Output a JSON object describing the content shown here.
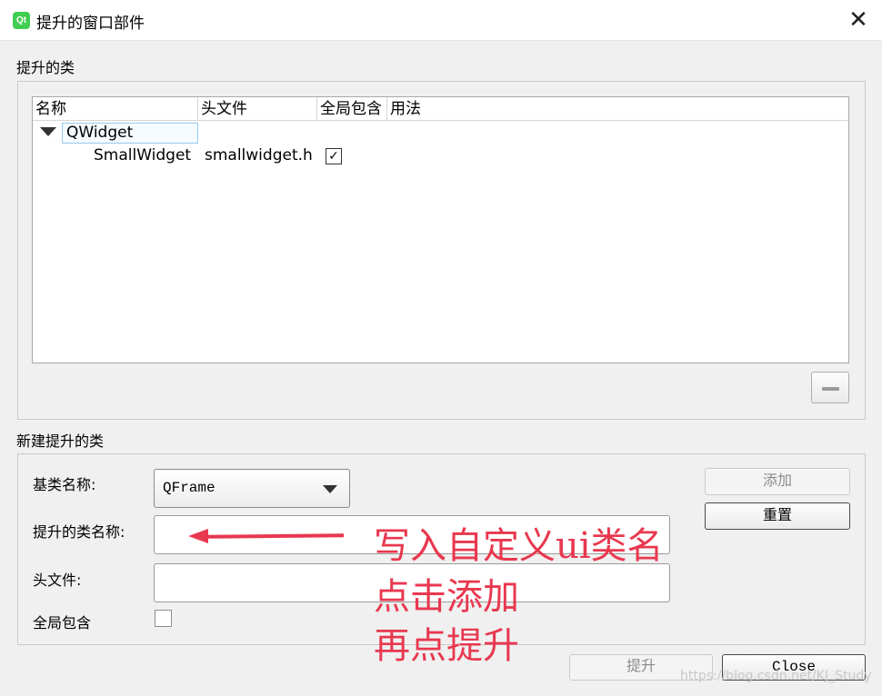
{
  "window": {
    "title": "提升的窗口部件",
    "icon_text": "Qt"
  },
  "promoted": {
    "section_label": "提升的类",
    "columns": [
      "名称",
      "头文件",
      "全局包含",
      "用法"
    ],
    "base_item": "QWidget",
    "child": {
      "name": "SmallWidget",
      "header": "smallwidget.h",
      "global_include_mark": "✓"
    }
  },
  "new_class": {
    "section_label": "新建提升的类",
    "base_label": "基类名称:",
    "base_value": "QFrame",
    "promoted_label": "提升的类名称:",
    "promoted_value": "",
    "header_label": "头文件:",
    "header_value": "",
    "global_label": "全局包含",
    "add_button": "添加",
    "reset_button": "重置"
  },
  "footer": {
    "promote_button": "提升",
    "close_button": "Close"
  },
  "annotation": {
    "line1": "写入自定义ui类名",
    "line2": "点击添加",
    "line3": "再点提升"
  },
  "watermark": "https://blog.csdn.net/KJ_Study",
  "colors": {
    "annotation": "#e8384f",
    "qt_green": "#41cd52"
  }
}
